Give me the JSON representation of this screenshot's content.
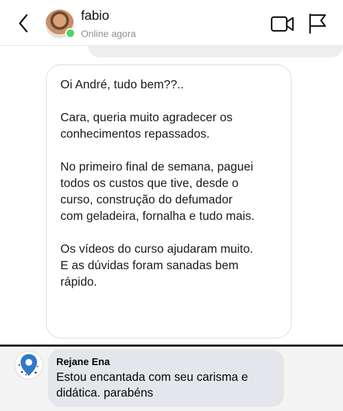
{
  "header": {
    "contact_name": "fabio",
    "status": "Online agora",
    "icons": {
      "back": "chevron-left-icon",
      "video": "video-camera-icon",
      "report": "flag-icon"
    },
    "online_color": "#4bd865"
  },
  "message": {
    "lines": [
      "Oi André, tudo bem??..",
      "",
      "Cara, queria muito agradecer os",
      "conhecimentos repassados.",
      "",
      "No primeiro final de semana, paguei",
      "todos os custos que tive, desde o",
      "curso, construção do defumador",
      "com geladeira, fornalha e tudo mais.",
      "",
      "Os vídeos do curso ajudaram muito.",
      "E as dúvidas foram sanadas bem",
      "rápido."
    ]
  },
  "comment": {
    "author": "Rejane Ena",
    "lines": [
      "Estou encantada com seu carisma e",
      "didática. parabéns"
    ]
  }
}
